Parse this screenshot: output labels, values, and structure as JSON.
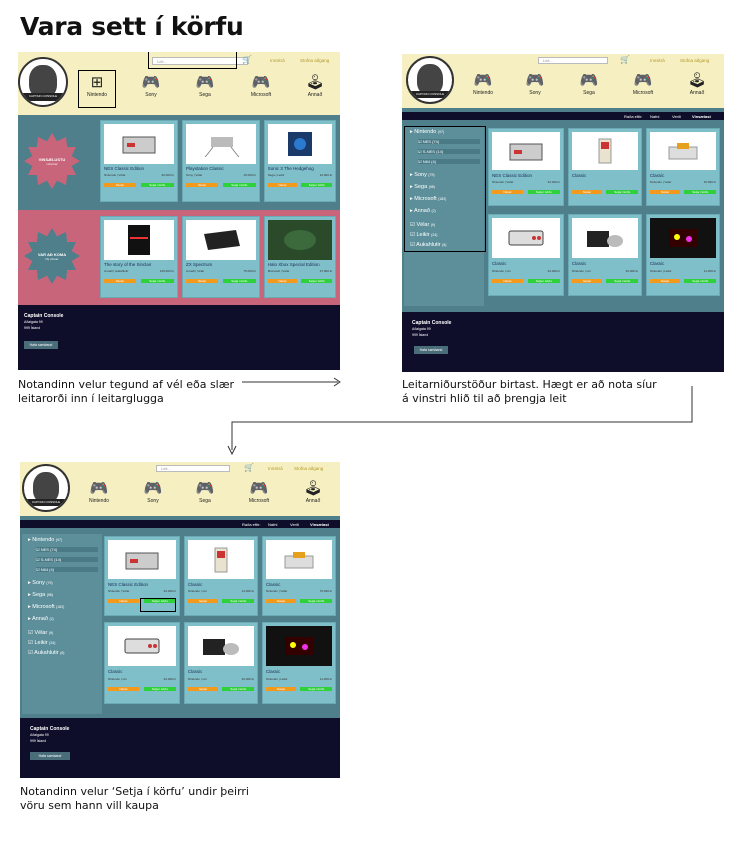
{
  "title": "Vara sett í körfu",
  "common": {
    "search_placeholder": "Leit...",
    "login": "Innskrá",
    "signup": "Stofna aðgang",
    "categories": [
      "Nintendo",
      "Sony",
      "Sega",
      "Microsoft",
      "Annað"
    ],
    "sort_label": "Raða eftir:",
    "sort_options": [
      "Nafni",
      "Verði",
      "Vinsælast"
    ],
    "view_button": "Nánar",
    "cart_button": "Setja í körfu",
    "footer_title": "Captain Console",
    "footer_address": "Aðalgata 99",
    "footer_city": "999 Ísland",
    "footer_button": "Hafa samband",
    "logo_text": "CAPTAIN CONSOLE"
  },
  "shot1": {
    "banner1": {
      "title": "VINSÆLUSTU",
      "sub": "vörurnar"
    },
    "banner2": {
      "title": "VAR AÐ KOMA",
      "sub": "Ný vöruer"
    },
    "products": [
      {
        "name": "NES Classic Edition",
        "meta": "Nintendo | Vélar",
        "price": "32.000 kr"
      },
      {
        "name": "Playstation Classic",
        "meta": "Sony | Vélar",
        "price": "15.000 kr"
      },
      {
        "name": "Sonic 3 The Hedgehog",
        "meta": "Sega | Leikir",
        "price": "16.000 kr"
      },
      {
        "name": "The story of the Sinclair",
        "meta": "Annað | Aukahlutir",
        "price": "125.000 kr"
      },
      {
        "name": "ZX Spectrum",
        "meta": "Annað | Vélar",
        "price": "75.000 kr"
      },
      {
        "name": "Halo Xbox Special Edition",
        "meta": "Microsoft | Vélar",
        "price": "47.000 kr"
      }
    ]
  },
  "caption1": "Notandinn velur tegund af vél eða slær leitarorði inn í leitarglugga",
  "filters": {
    "items": [
      {
        "label": "Nintendo",
        "count": "(97)"
      },
      {
        "label": "Sony",
        "count": "(79)"
      },
      {
        "label": "Sega",
        "count": "(98)"
      },
      {
        "label": "Microsoft",
        "count": "(182)"
      },
      {
        "label": "Annað",
        "count": "(2)"
      }
    ],
    "subs": [
      {
        "label": "NES",
        "count": "(74)"
      },
      {
        "label": "S-NES",
        "count": "(14)"
      },
      {
        "label": "N64",
        "count": "(4)"
      }
    ],
    "types": [
      {
        "label": "Vélar",
        "count": "(9)"
      },
      {
        "label": "Leikir",
        "count": "(24)"
      },
      {
        "label": "Aukahlutir",
        "count": "(6)"
      }
    ]
  },
  "shot2": {
    "products": [
      {
        "name": "NES Classic Edition",
        "meta": "Nintendo | Vélar",
        "price": "32.000 kr"
      },
      {
        "name": "Classic",
        "meta": "",
        "price": ""
      },
      {
        "name": "Classic",
        "meta": "Nintendo | Vélar",
        "price": "15.000 kr"
      },
      {
        "name": "Classic",
        "meta": "Nintendo | xxx",
        "price": "32.000 kr"
      },
      {
        "name": "Classic",
        "meta": "Nintendo | xxx",
        "price": "32.000 kr"
      },
      {
        "name": "Classic",
        "meta": "Nintendo | Leikir",
        "price": "11.000 kr"
      }
    ]
  },
  "caption2": "Leitarniðurstöður birtast. Hægt er að nota síur á vinstri hlið til að þrengja leit",
  "shot3": {
    "products": [
      {
        "name": "NES Classic Edition",
        "meta": "Nintendo | Vélar",
        "price": "32.000 kr"
      },
      {
        "name": "Classic",
        "meta": "Nintendo | xxx",
        "price": "14.000 kr"
      },
      {
        "name": "Classic",
        "meta": "Nintendo | Vélar",
        "price": "70.000 kr"
      },
      {
        "name": "Classic",
        "meta": "Nintendo | xxx",
        "price": "32.000 kr"
      },
      {
        "name": "Classic",
        "meta": "Nintendo | xxx",
        "price": "32.000 kr"
      },
      {
        "name": "Classic",
        "meta": "Nintendo | Leikir",
        "price": "11.000 kr"
      }
    ]
  },
  "caption3": "Notandinn velur ‘Setja í körfu’ undir þeirri vöru sem hann vill kaupa"
}
